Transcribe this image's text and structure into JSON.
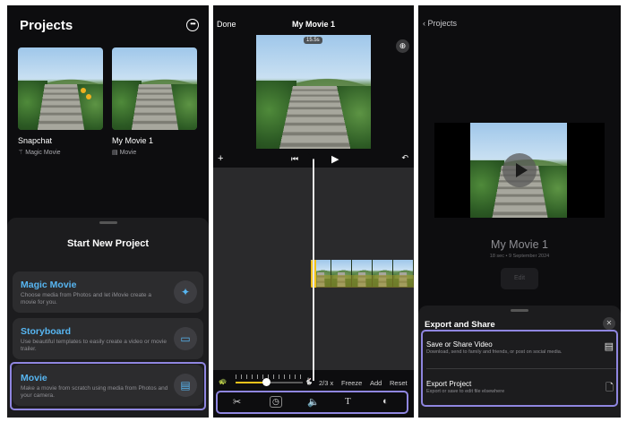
{
  "panel1": {
    "title": "Projects",
    "more_icon": "ellipsis-circle-icon",
    "projects": [
      {
        "name": "Snapchat",
        "type": "Magic Movie",
        "type_icon": "magic-wand-icon"
      },
      {
        "name": "My Movie 1",
        "type": "Movie",
        "type_icon": "film-icon"
      }
    ],
    "sheet_title": "Start New Project",
    "options": [
      {
        "title": "Magic Movie",
        "desc": "Choose media from Photos and let iMovie create a movie for you.",
        "icon": "magic-wand-icon"
      },
      {
        "title": "Storyboard",
        "desc": "Use beautiful templates to easily create a video or movie trailer.",
        "icon": "storyboard-icon"
      },
      {
        "title": "Movie",
        "desc": "Make a movie from scratch using media from Photos and your camera.",
        "icon": "film-icon"
      }
    ]
  },
  "panel2": {
    "done": "Done",
    "title": "My Movie 1",
    "duration_badge": "15.5s",
    "speed_label": "2/3 x",
    "speed_fraction": 0.45,
    "freeze": "Freeze",
    "add": "Add",
    "reset": "Reset",
    "tools": [
      "scissors-icon",
      "speed-icon",
      "volume-icon",
      "text-icon",
      "filters-icon"
    ]
  },
  "panel3": {
    "back": "Projects",
    "movie_title": "My Movie 1",
    "meta": "18 sec • 9 September 2024",
    "edit": "Edit",
    "share_title": "Export and Share",
    "rows": [
      {
        "title": "Save or Share Video",
        "desc": "Download, send to family and friends, or post on social media.",
        "icon": "film-icon"
      },
      {
        "title": "Export Project",
        "desc": "Export or save to edit file elsewhere",
        "icon": "document-icon"
      }
    ]
  },
  "colors": {
    "accent": "#57b6f2",
    "highlight": "#8f86e0",
    "trim": "#f1c21b",
    "background": "#0d0d0f"
  }
}
